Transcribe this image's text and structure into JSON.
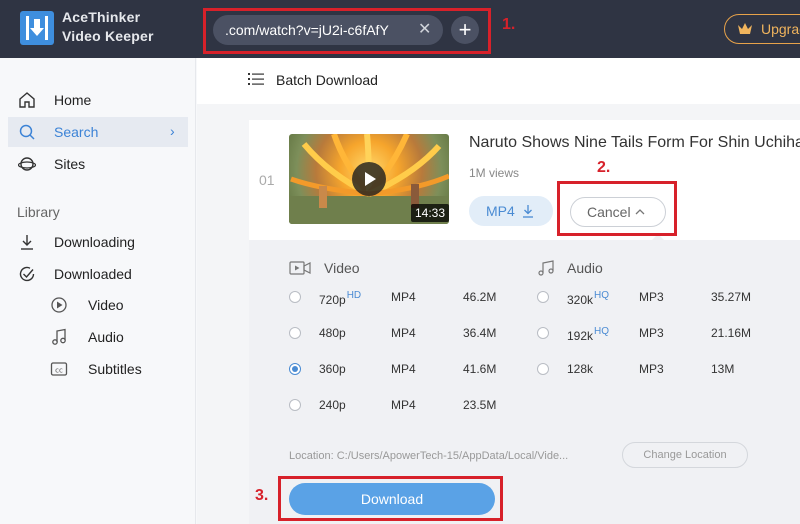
{
  "app": {
    "brand_line1": "AceThinker",
    "brand_line2": "Video Keeper"
  },
  "header": {
    "url_value": ".com/watch?v=jU2i-c6fAfY",
    "clear": "✕",
    "add": "+",
    "upgrade_label": "Upgrade"
  },
  "sidebar": {
    "items": [
      {
        "label": "Home",
        "icon": "home-icon"
      },
      {
        "label": "Search",
        "icon": "search-icon",
        "active": true
      },
      {
        "label": "Sites",
        "icon": "planet-icon"
      }
    ],
    "library_title": "Library",
    "library": [
      {
        "label": "Downloading",
        "icon": "download-icon"
      },
      {
        "label": "Downloaded",
        "icon": "check-circle-icon"
      }
    ],
    "sub": [
      {
        "label": "Video",
        "icon": "play-circle-icon"
      },
      {
        "label": "Audio",
        "icon": "music-note-icon"
      },
      {
        "label": "Subtitles",
        "icon": "cc-icon"
      }
    ]
  },
  "main": {
    "batch_label": "Batch Download",
    "item": {
      "index": "01",
      "title": "Naruto Shows Nine Tails Form For Shin Uchiha",
      "views": "1M views",
      "duration": "14:33",
      "format_button": "MP4",
      "cancel_button": "Cancel"
    },
    "video_section": "Video",
    "audio_section": "Audio",
    "video_options": [
      {
        "quality": "720p",
        "badge": "HD",
        "format": "MP4",
        "size": "46.2M",
        "selected": false
      },
      {
        "quality": "480p",
        "badge": "",
        "format": "MP4",
        "size": "36.4M",
        "selected": false
      },
      {
        "quality": "360p",
        "badge": "",
        "format": "MP4",
        "size": "41.6M",
        "selected": true
      },
      {
        "quality": "240p",
        "badge": "",
        "format": "MP4",
        "size": "23.5M",
        "selected": false
      }
    ],
    "audio_options": [
      {
        "quality": "320k",
        "badge": "HQ",
        "format": "MP3",
        "size": "35.27M",
        "selected": false
      },
      {
        "quality": "192k",
        "badge": "HQ",
        "format": "MP3",
        "size": "21.16M",
        "selected": false
      },
      {
        "quality": "128k",
        "badge": "",
        "format": "MP3",
        "size": "13M",
        "selected": false
      }
    ],
    "location": "Location: C:/Users/ApowerTech-15/AppData/Local/Vide...",
    "change_location": "Change Location",
    "download_button": "Download"
  },
  "annotations": {
    "one": "1.",
    "two": "2.",
    "three": "3."
  },
  "colors": {
    "accent": "#4a8bd3",
    "annotation": "#d7212a",
    "header": "#2f3443"
  }
}
